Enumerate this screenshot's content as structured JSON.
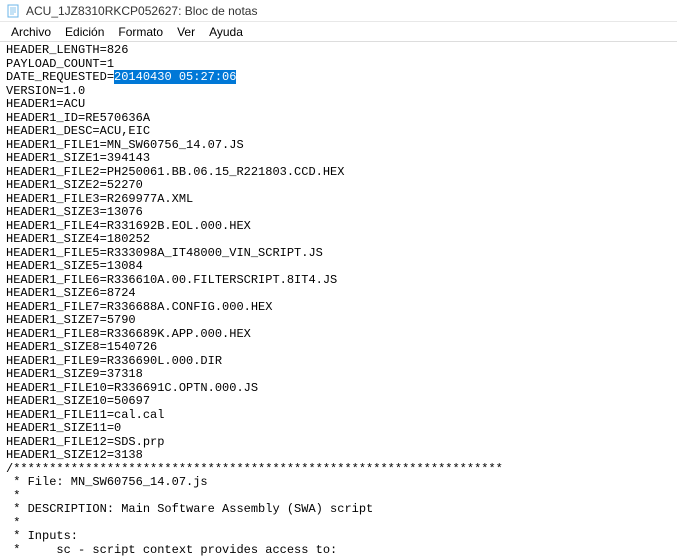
{
  "window": {
    "title": "ACU_1JZ8310RKCP052627: Bloc de notas"
  },
  "menu": {
    "archivo": "Archivo",
    "edicion": "Edición",
    "formato": "Formato",
    "ver": "Ver",
    "ayuda": "Ayuda"
  },
  "editor": {
    "selection": "20140430 05:27:06",
    "lines": [
      "HEADER_LENGTH=826",
      "PAYLOAD_COUNT=1",
      "DATE_REQUESTED=",
      "VERSION=1.0",
      "HEADER1=ACU",
      "HEADER1_ID=RE570636A",
      "HEADER1_DESC=ACU,EIC",
      "HEADER1_FILE1=MN_SW60756_14.07.JS",
      "HEADER1_SIZE1=394143",
      "HEADER1_FILE2=PH250061.BB.06.15_R221803.CCD.HEX",
      "HEADER1_SIZE2=52270",
      "HEADER1_FILE3=R269977A.XML",
      "HEADER1_SIZE3=13076",
      "HEADER1_FILE4=R331692B.EOL.000.HEX",
      "HEADER1_SIZE4=180252",
      "HEADER1_FILE5=R333098A_IT48000_VIN_SCRIPT.JS",
      "HEADER1_SIZE5=13084",
      "HEADER1_FILE6=R336610A.00.FILTERSCRIPT.8IT4.JS",
      "HEADER1_SIZE6=8724",
      "HEADER1_FILE7=R336688A.CONFIG.000.HEX",
      "HEADER1_SIZE7=5790",
      "HEADER1_FILE8=R336689K.APP.000.HEX",
      "HEADER1_SIZE8=1540726",
      "HEADER1_FILE9=R336690L.000.DIR",
      "HEADER1_SIZE9=37318",
      "HEADER1_FILE10=R336691C.OPTN.000.JS",
      "HEADER1_SIZE10=50697",
      "HEADER1_FILE11=cal.cal",
      "HEADER1_SIZE11=0",
      "HEADER1_FILE12=SDS.prp",
      "HEADER1_SIZE12=3138",
      "/********************************************************************",
      " * File: MN_SW60756_14.07.js",
      " *",
      " * DESCRIPTION: Main Software Assembly (SWA) script",
      " *",
      " * Inputs:",
      " *     sc - script context provides access to:"
    ]
  }
}
